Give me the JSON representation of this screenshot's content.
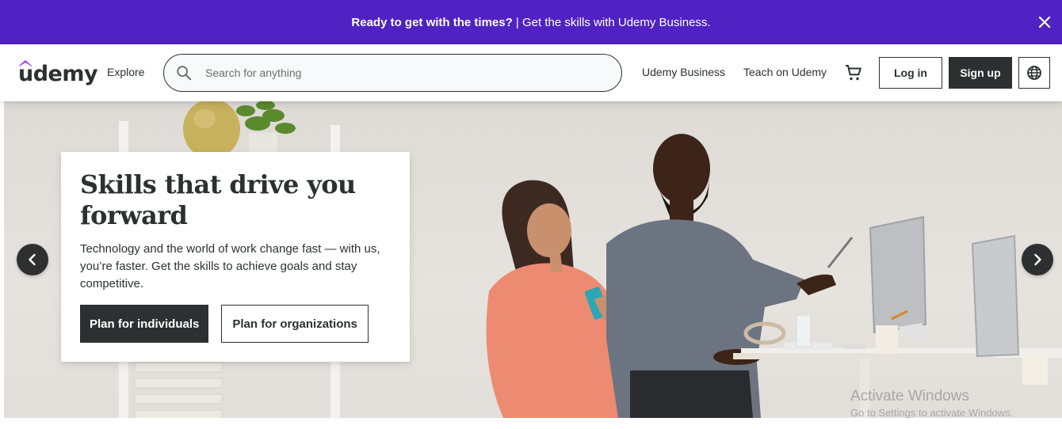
{
  "promo": {
    "bold": "Ready to get with the times?",
    "text": " | Get the skills with Udemy Business."
  },
  "header": {
    "logo": "udemy",
    "explore": "Explore",
    "search_placeholder": "Search for anything",
    "links": [
      "Udemy Business",
      "Teach on Udemy"
    ],
    "login": "Log in",
    "signup": "Sign up"
  },
  "hero": {
    "title": "Skills that drive you forward",
    "body": "Technology and the world of work change fast — with us, you’re faster. Get the skills to achieve goals and stay competitive.",
    "primary_button": "Plan for individuals",
    "secondary_button": "Plan for organizations"
  },
  "watermark": {
    "title": "Activate Windows",
    "subtitle": "Go to Settings to activate Windows."
  },
  "colors": {
    "promo_bg": "#5022c3",
    "logo_accent": "#a435f0",
    "dark": "#2d2f31"
  },
  "icons": [
    "close-icon",
    "search-icon",
    "cart-icon",
    "globe-icon",
    "chevron-left-icon",
    "chevron-right-icon"
  ]
}
